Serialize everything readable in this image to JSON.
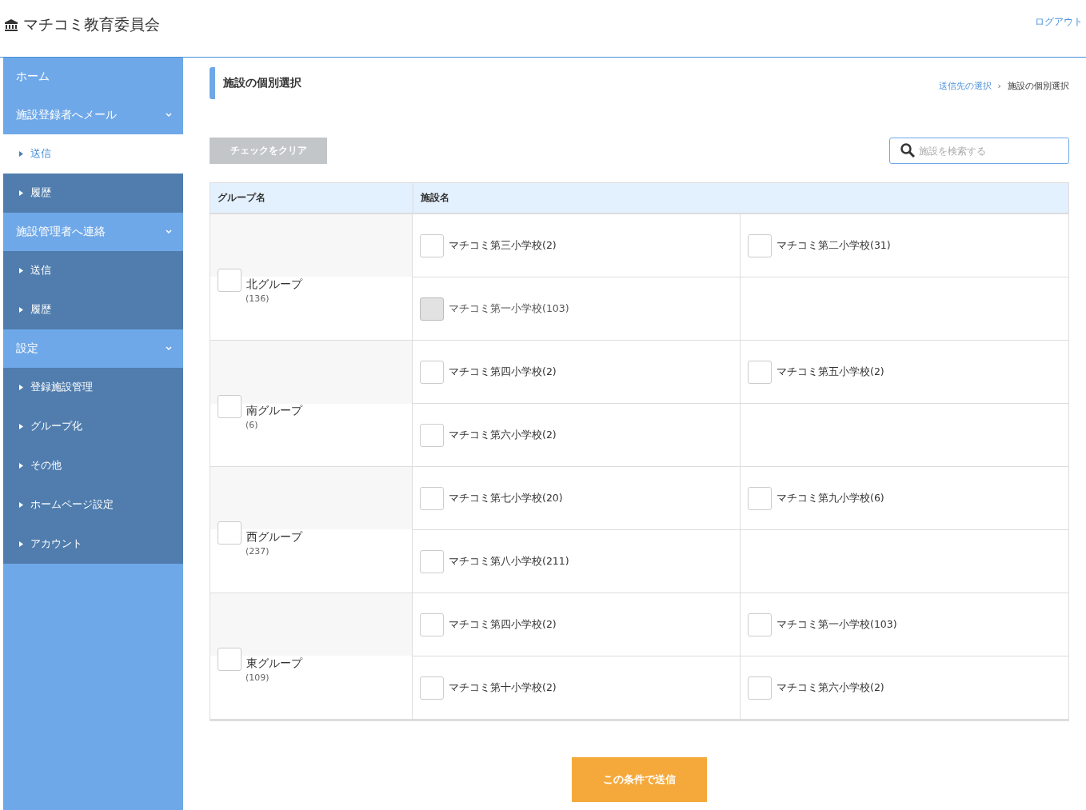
{
  "header": {
    "title": "マチコミ教育委員会",
    "logout": "ログアウト"
  },
  "sidebar": {
    "items": [
      {
        "kind": "link",
        "label": "ホーム",
        "selected": false
      },
      {
        "kind": "section",
        "label": "施設登録者へメール",
        "expanded": true,
        "selected": false
      },
      {
        "kind": "sub",
        "label": "送信",
        "selected": true
      },
      {
        "kind": "sub",
        "label": "履歴",
        "selected": false
      },
      {
        "kind": "section",
        "label": "施設管理者へ連絡",
        "expanded": true,
        "selected": false
      },
      {
        "kind": "sub",
        "label": "送信",
        "selected": false
      },
      {
        "kind": "sub",
        "label": "履歴",
        "selected": false
      },
      {
        "kind": "section",
        "label": "設定",
        "expanded": true,
        "selected": false
      },
      {
        "kind": "sub",
        "label": "登録施設管理",
        "selected": false
      },
      {
        "kind": "sub",
        "label": "グループ化",
        "selected": false
      },
      {
        "kind": "sub",
        "label": "その他",
        "selected": false
      },
      {
        "kind": "sub",
        "label": "ホームページ設定",
        "selected": false
      },
      {
        "kind": "sub",
        "label": "アカウント",
        "selected": false
      }
    ]
  },
  "page": {
    "title": "施設の個別選択",
    "breadcrumb_separator": "›",
    "breadcrumb": [
      {
        "label": "送信先の選択",
        "link": true
      },
      {
        "label": "施設の個別選択",
        "link": false
      }
    ]
  },
  "clear_button": "チェックをクリア",
  "search": {
    "placeholder": "施設を検索する"
  },
  "table": {
    "columns": [
      "グループ名",
      "施設名"
    ],
    "groups": [
      {
        "name": "北グループ",
        "count": "(136)",
        "checked": false,
        "facilities": [
          {
            "name": "マチコミ第三小学校(2)",
            "checked": false,
            "disabled": false
          },
          {
            "name": "マチコミ第二小学校(31)",
            "checked": false,
            "disabled": false
          },
          {
            "name": "マチコミ第一小学校(103)",
            "checked": false,
            "disabled": true
          }
        ]
      },
      {
        "name": "南グループ",
        "count": "(6)",
        "checked": false,
        "facilities": [
          {
            "name": "マチコミ第四小学校(2)",
            "checked": false,
            "disabled": false
          },
          {
            "name": "マチコミ第五小学校(2)",
            "checked": false,
            "disabled": false
          },
          {
            "name": "マチコミ第六小学校(2)",
            "checked": false,
            "disabled": false
          }
        ]
      },
      {
        "name": "西グループ",
        "count": "(237)",
        "checked": false,
        "facilities": [
          {
            "name": "マチコミ第七小学校(20)",
            "checked": false,
            "disabled": false
          },
          {
            "name": "マチコミ第九小学校(6)",
            "checked": false,
            "disabled": false
          },
          {
            "name": "マチコミ第八小学校(211)",
            "checked": false,
            "disabled": false
          }
        ]
      },
      {
        "name": "東グループ",
        "count": "(109)",
        "checked": false,
        "facilities": [
          {
            "name": "マチコミ第四小学校(2)",
            "checked": false,
            "disabled": false
          },
          {
            "name": "マチコミ第一小学校(103)",
            "checked": false,
            "disabled": false
          },
          {
            "name": "マチコミ第十小学校(2)",
            "checked": false,
            "disabled": false
          },
          {
            "name": "マチコミ第六小学校(2)",
            "checked": false,
            "disabled": false
          }
        ]
      }
    ]
  },
  "submit_button": "この条件で送信"
}
